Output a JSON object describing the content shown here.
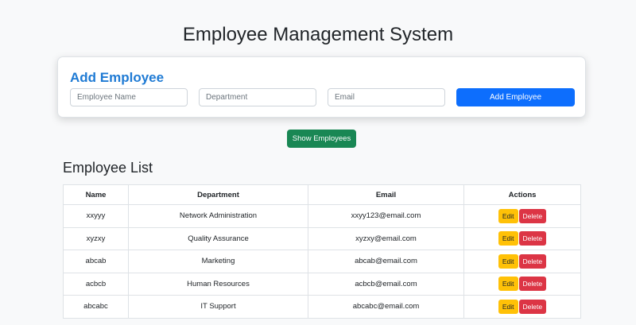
{
  "page": {
    "title": "Employee Management System"
  },
  "add_form": {
    "title": "Add Employee",
    "name_placeholder": "Employee Name",
    "name_value": "",
    "department_placeholder": "Department",
    "department_value": "",
    "email_placeholder": "Email",
    "email_value": "",
    "submit_label": "Add Employee"
  },
  "show_button_label": "Show Employees",
  "employee_list": {
    "title": "Employee List",
    "headers": [
      "Name",
      "Department",
      "Email",
      "Actions"
    ],
    "edit_label": "Edit",
    "delete_label": "Delete",
    "rows": [
      {
        "name": "xxyyy",
        "department": "Network Administration",
        "email": "xxyy123@email.com"
      },
      {
        "name": "xyzxy",
        "department": "Quality Assurance",
        "email": "xyzxy@email.com"
      },
      {
        "name": "abcab",
        "department": "Marketing",
        "email": "abcab@email.com"
      },
      {
        "name": "acbcb",
        "department": "Human Resources",
        "email": "acbcb@email.com"
      },
      {
        "name": "abcabc",
        "department": "IT Support",
        "email": "abcabc@email.com"
      }
    ]
  },
  "colors": {
    "primary": "#0d6efd",
    "success": "#198754",
    "warning": "#ffc107",
    "danger": "#dc3545",
    "heading_blue": "#1e7ad4"
  }
}
